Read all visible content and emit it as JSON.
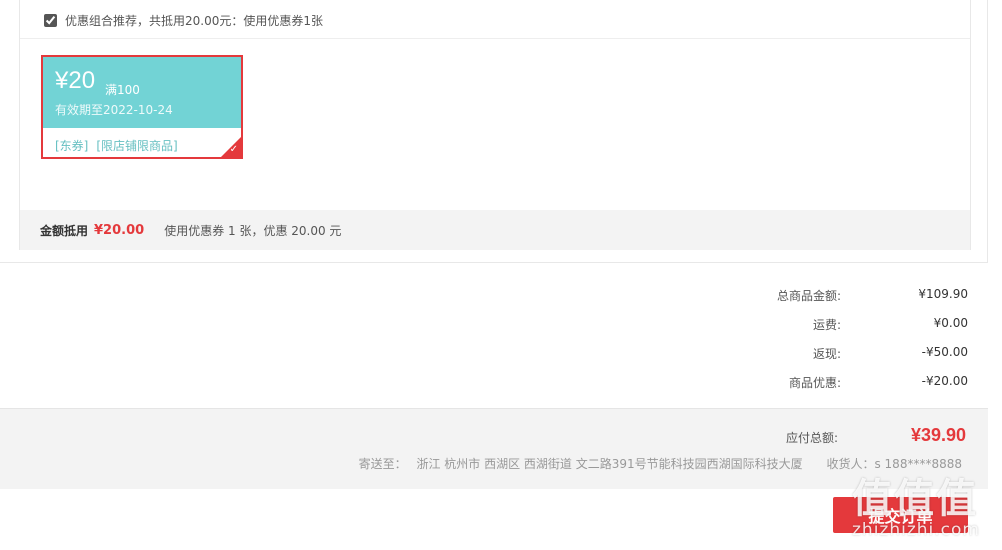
{
  "coupon_section": {
    "combo_checked": true,
    "combo_text": "优惠组合推荐，共抵用20.00元：使用优惠券1张",
    "coupon": {
      "amount": "¥20",
      "condition": "满100",
      "valid": "有效期至2022-10-24",
      "tags": [
        "[东券]",
        "[限店铺限商品]"
      ],
      "selected": true
    },
    "summary": {
      "label": "金额抵用",
      "value": "¥20.00",
      "desc": "使用优惠券 1 张，优惠 20.00 元"
    }
  },
  "price_breakdown": [
    {
      "label": "总商品金额:",
      "value": "¥109.90"
    },
    {
      "label": "运费:",
      "value": "¥0.00"
    },
    {
      "label": "返现:",
      "value": "-¥50.00"
    },
    {
      "label": "商品优惠:",
      "value": "-¥20.00"
    }
  ],
  "total": {
    "label": "应付总额:",
    "amount": "¥39.90",
    "ship_to_label": "寄送至：",
    "address": "浙江 杭州市 西湖区 西湖街道 文二路391号节能科技园西湖国际科技大厦",
    "receiver": "收货人：s 188****8888"
  },
  "submit_label": "提交订单",
  "watermark": {
    "logo": "值值值",
    "text": "zhizhizhi.com"
  },
  "colors": {
    "accent": "#e4393c",
    "coupon_bg": "#72d3d5",
    "panel_bg": "#f3f3f3"
  }
}
